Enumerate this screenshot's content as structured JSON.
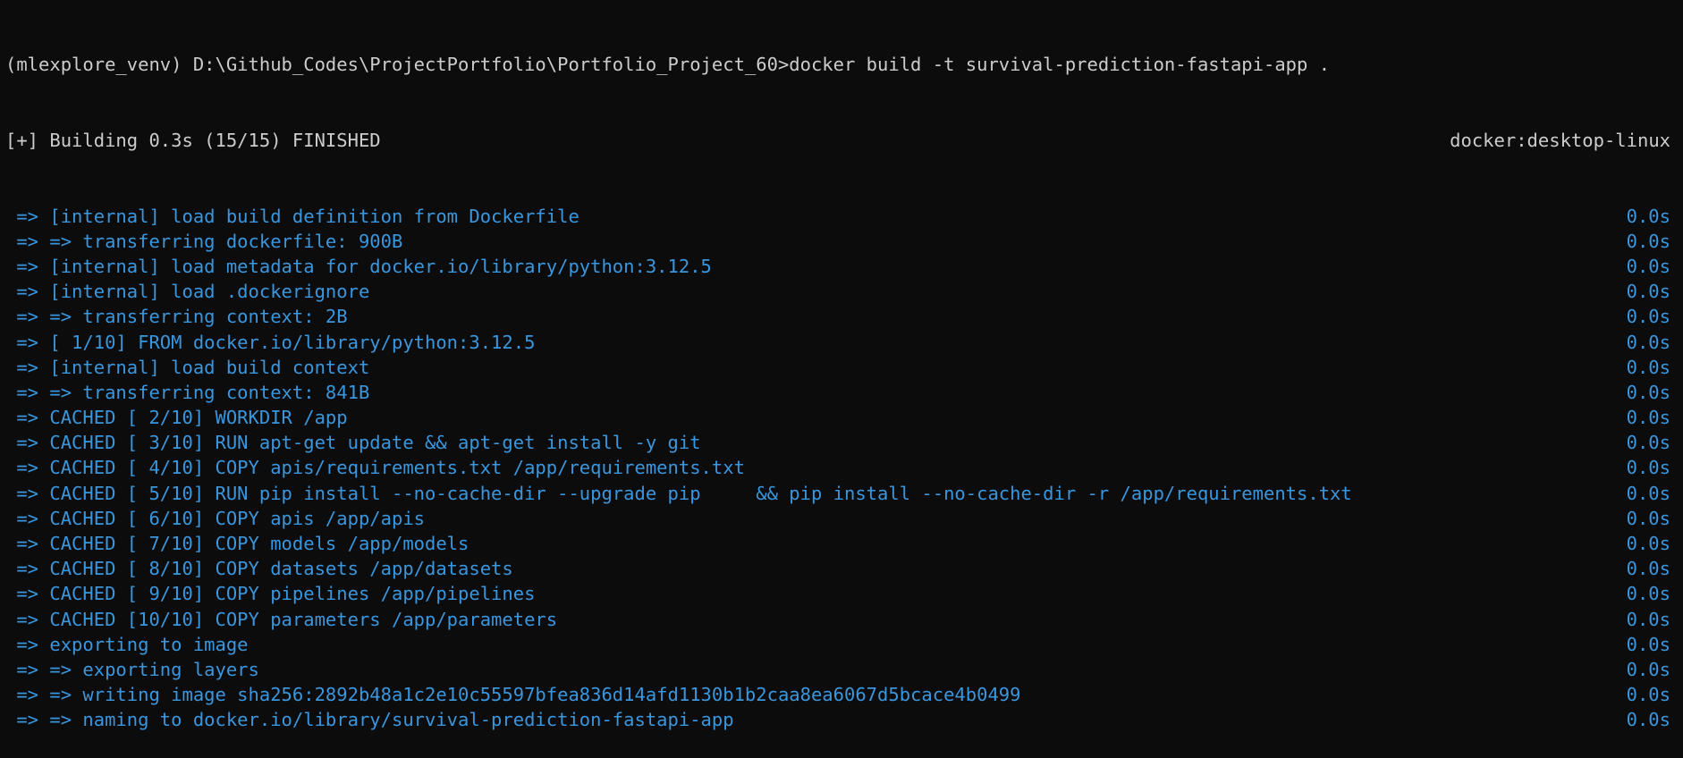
{
  "terminal": {
    "colors": {
      "background": "#0c0c0c",
      "foreground": "#cccccc",
      "step": "#3a96dd"
    },
    "prompt_line": "(mlexplore_venv) D:\\Github_Codes\\ProjectPortfolio\\Portfolio_Project_60>docker build -t survival-prediction-fastapi-app .",
    "status": {
      "text": "[+] Building 0.3s (15/15) FINISHED",
      "context": "docker:desktop-linux"
    },
    "steps": [
      {
        "text": " => [internal] load build definition from Dockerfile",
        "time": "0.0s"
      },
      {
        "text": " => => transferring dockerfile: 900B",
        "time": "0.0s"
      },
      {
        "text": " => [internal] load metadata for docker.io/library/python:3.12.5",
        "time": "0.0s"
      },
      {
        "text": " => [internal] load .dockerignore",
        "time": "0.0s"
      },
      {
        "text": " => => transferring context: 2B",
        "time": "0.0s"
      },
      {
        "text": " => [ 1/10] FROM docker.io/library/python:3.12.5",
        "time": "0.0s"
      },
      {
        "text": " => [internal] load build context",
        "time": "0.0s"
      },
      {
        "text": " => => transferring context: 841B",
        "time": "0.0s"
      },
      {
        "text": " => CACHED [ 2/10] WORKDIR /app",
        "time": "0.0s"
      },
      {
        "text": " => CACHED [ 3/10] RUN apt-get update && apt-get install -y git",
        "time": "0.0s"
      },
      {
        "text": " => CACHED [ 4/10] COPY apis/requirements.txt /app/requirements.txt",
        "time": "0.0s"
      },
      {
        "text": " => CACHED [ 5/10] RUN pip install --no-cache-dir --upgrade pip     && pip install --no-cache-dir -r /app/requirements.txt",
        "time": "0.0s"
      },
      {
        "text": " => CACHED [ 6/10] COPY apis /app/apis",
        "time": "0.0s"
      },
      {
        "text": " => CACHED [ 7/10] COPY models /app/models",
        "time": "0.0s"
      },
      {
        "text": " => CACHED [ 8/10] COPY datasets /app/datasets",
        "time": "0.0s"
      },
      {
        "text": " => CACHED [ 9/10] COPY pipelines /app/pipelines",
        "time": "0.0s"
      },
      {
        "text": " => CACHED [10/10] COPY parameters /app/parameters",
        "time": "0.0s"
      },
      {
        "text": " => exporting to image",
        "time": "0.0s"
      },
      {
        "text": " => => exporting layers",
        "time": "0.0s"
      },
      {
        "text": " => => writing image sha256:2892b48a1c2e10c55597bfea836d14afd1130b1b2caa8ea6067d5bcace4b0499",
        "time": "0.0s"
      },
      {
        "text": " => => naming to docker.io/library/survival-prediction-fastapi-app",
        "time": "0.0s"
      }
    ]
  }
}
